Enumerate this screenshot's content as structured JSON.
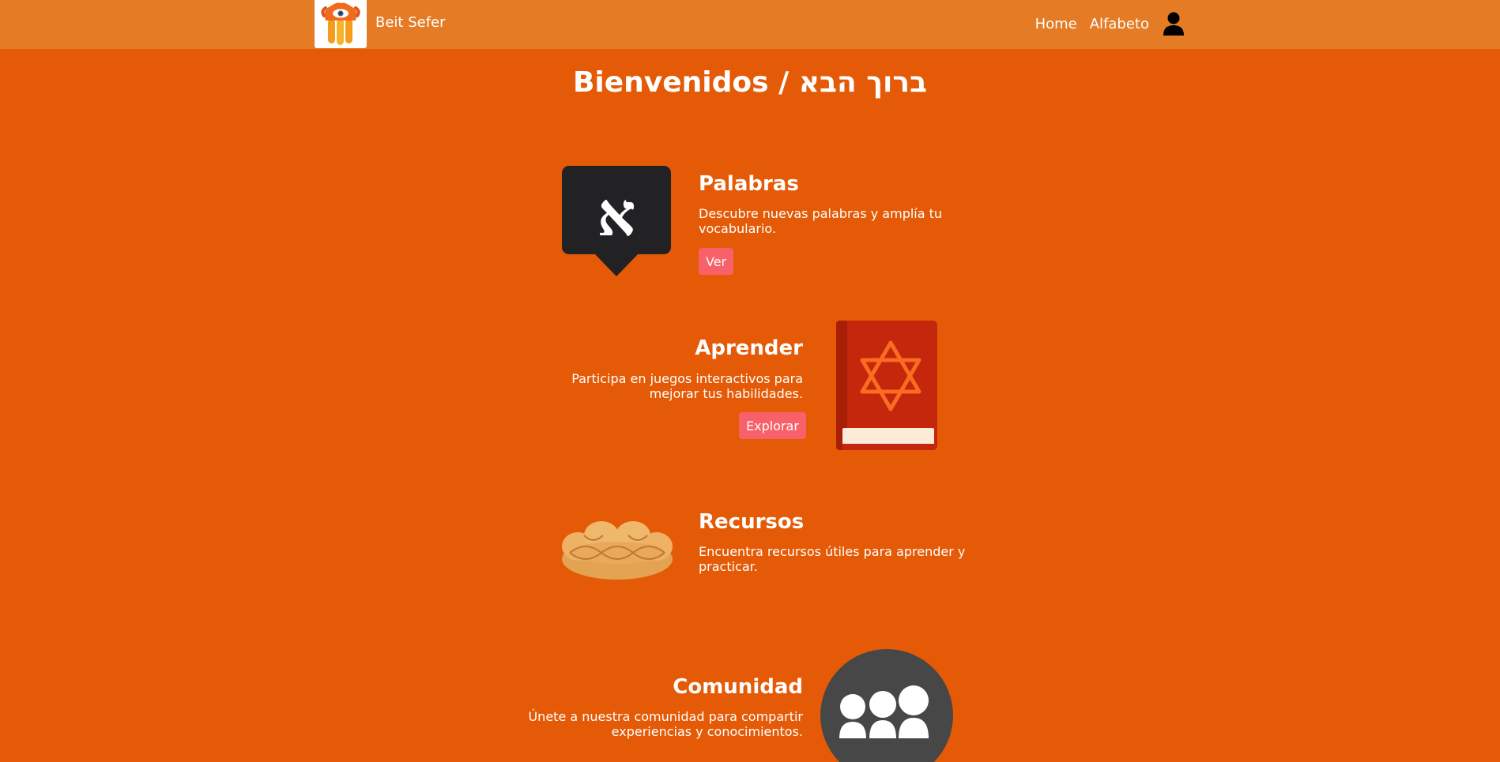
{
  "navbar": {
    "brand": "Beit Sefer",
    "links": [
      "Home",
      "Alfabeto"
    ],
    "user_icon": "user-icon"
  },
  "page": {
    "title": "Bienvenidos / ברוך הבא"
  },
  "cards": [
    {
      "title": "Palabras",
      "description": "Descubre nuevas palabras y amplía tu vocabulario.",
      "button": "Ver",
      "icon": "aleph-speech-bubble-icon",
      "icon_glyph": "א"
    },
    {
      "title": "Aprender",
      "description": "Participa en juegos interactivos para mejorar tus habilidades.",
      "button": "Explorar",
      "icon": "star-of-david-book-icon"
    },
    {
      "title": "Recursos",
      "description": "Encuentra recursos útiles para aprender y practicar.",
      "icon": "challah-bread-icon"
    },
    {
      "title": "Comunidad",
      "description": "Únete a nuestra comunidad para compartir experiencias y conocimientos.",
      "icon": "community-group-icon"
    }
  ],
  "colors": {
    "background": "#e55a06",
    "navbar": "#e57b24",
    "button": "#f8606a"
  }
}
